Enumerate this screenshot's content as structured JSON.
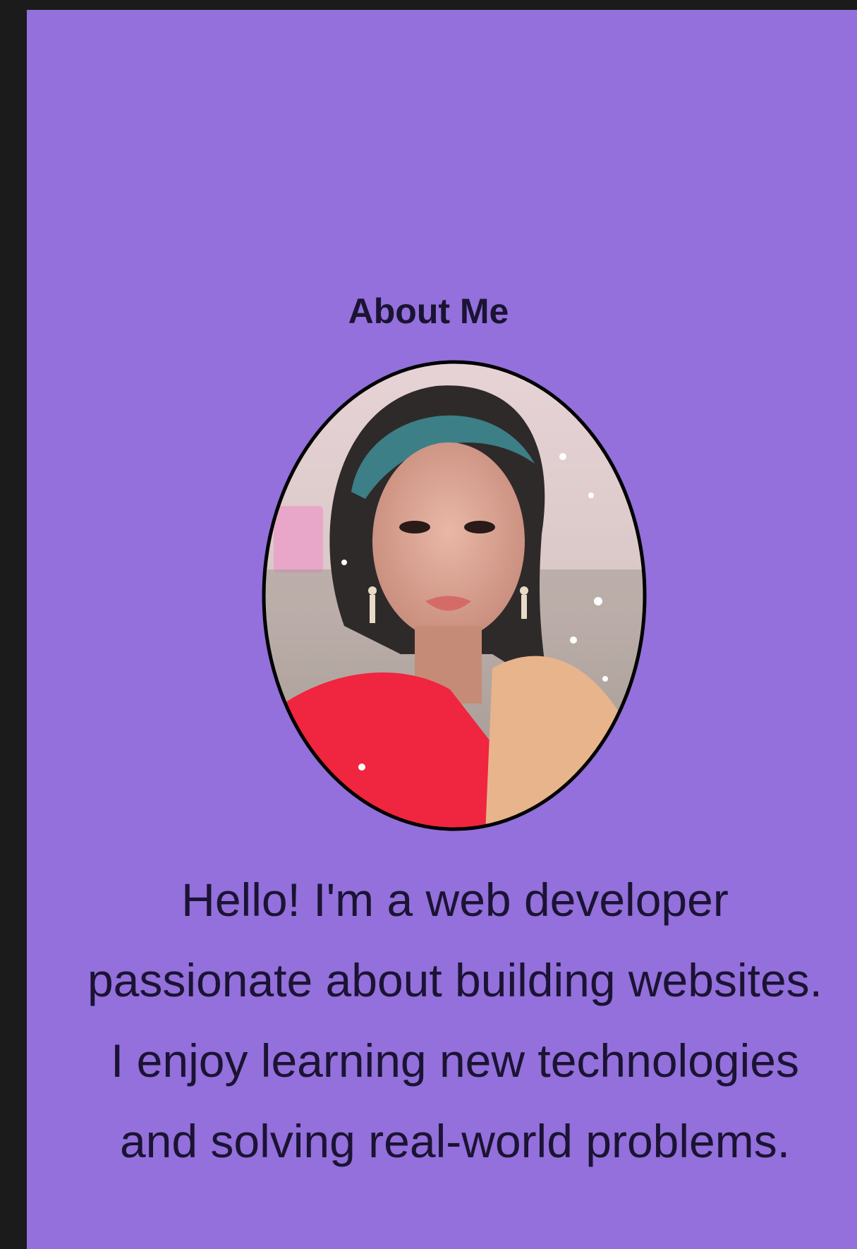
{
  "about": {
    "title": "About Me",
    "bio_lines": [
      "Hello! I'm a web developer",
      "passionate about building websites.",
      "I enjoy learning new technologies",
      "and solving real-world problems."
    ]
  },
  "colors": {
    "panel_bg": "#9370db",
    "outer_bg": "#1b1b1b",
    "text": "#1b1333",
    "avatar_border": "#000000"
  },
  "icons": {
    "avatar": "profile-photo"
  }
}
